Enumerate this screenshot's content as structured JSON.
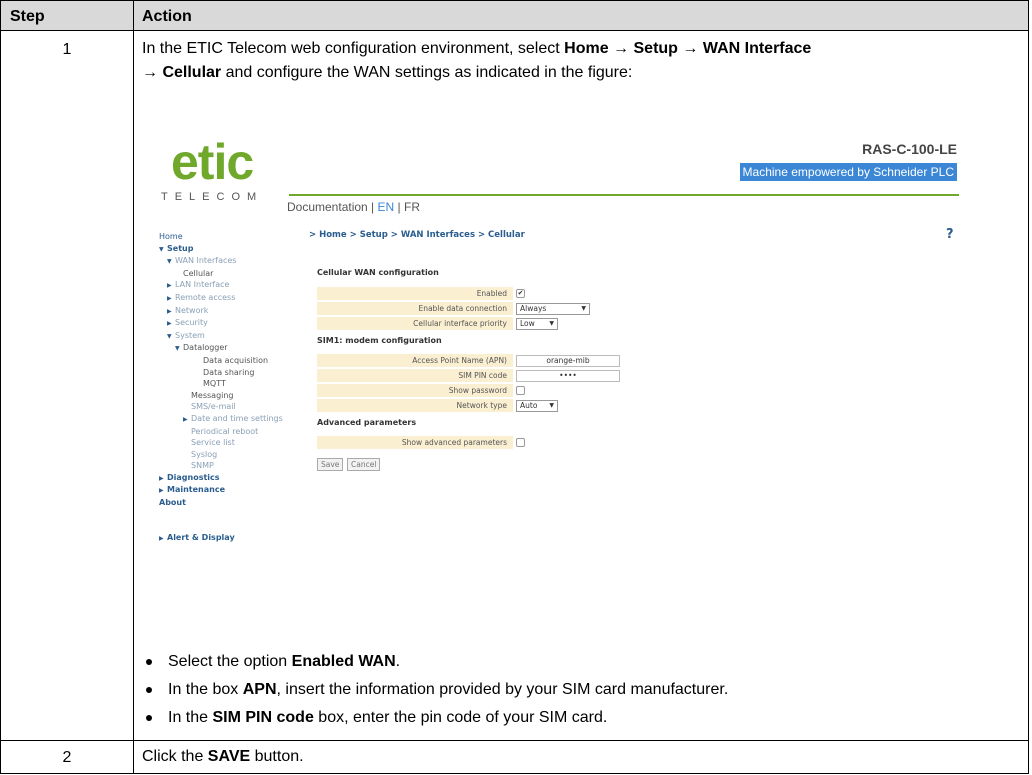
{
  "table": {
    "header_step": "Step",
    "header_action": "Action",
    "row1": {
      "step": "1",
      "intro_a": "In the ETIC Telecom web configuration environment, select ",
      "path": [
        "Home",
        "Setup",
        "WAN Interface",
        "Cellular"
      ],
      "arrow": "→",
      "intro_b": " and configure the WAN settings as indicated in the figure:",
      "bullets": [
        {
          "pre": "Select the option ",
          "bold": "Enabled WAN",
          "post": "."
        },
        {
          "pre": "In the box ",
          "bold": "APN",
          "post": ", insert the information provided by your SIM card manufacturer."
        },
        {
          "pre": "In the ",
          "bold": "SIM PIN code",
          "post": " box, enter the pin code of your SIM card."
        }
      ]
    },
    "row2": {
      "step": "2",
      "pre": "Click the ",
      "bold": "SAVE",
      "post": " button."
    }
  },
  "screenshot": {
    "logo_word": "etic",
    "logo_sub": "TELECOM",
    "device_name": "RAS-C-100-LE",
    "tagline": "Machine empowered by Schneider PLC",
    "doc_links": {
      "documentation": "Documentation",
      "sep1": " | ",
      "en": "EN",
      "sep2": " | ",
      "fr": "FR"
    },
    "breadcrumb": "> Home > Setup > WAN Interfaces > Cellular",
    "help": "?",
    "nav": {
      "home": "Home",
      "setup": "Setup",
      "wan_interfaces": "WAN Interfaces",
      "cellular": "Cellular",
      "lan_interface": "LAN Interface",
      "remote_access": "Remote access",
      "network": "Network",
      "security": "Security",
      "system": "System",
      "datalogger": "Datalogger",
      "data_acquisition": "Data acquisition",
      "data_sharing": "Data sharing",
      "mqtt": "MQTT",
      "messaging": "Messaging",
      "sms_email": "SMS/e-mail",
      "date_time": "Date and time settings",
      "periodical_reboot": "Periodical reboot",
      "service_list": "Service list",
      "syslog": "Syslog",
      "snmp": "SNMP",
      "diagnostics": "Diagnostics",
      "maintenance": "Maintenance",
      "about": "About",
      "alert_display": "Alert & Display"
    },
    "form": {
      "section_cellular": "Cellular WAN configuration",
      "enabled_label": "Enabled",
      "enabled_checked": true,
      "data_conn_label": "Enable data connection",
      "data_conn_value": "Always",
      "priority_label": "Cellular interface priority",
      "priority_value": "Low",
      "section_sim": "SIM1: modem configuration",
      "apn_label": "Access Point Name (APN)",
      "apn_value": "orange-mib",
      "pin_label": "SIM PIN code",
      "pin_value": "••••",
      "show_pw_label": "Show password",
      "net_type_label": "Network type",
      "net_type_value": "Auto",
      "section_adv": "Advanced parameters",
      "show_adv_label": "Show advanced parameters",
      "save": "Save",
      "cancel": "Cancel",
      "select_arrow": "▼",
      "check_mark": "✔"
    },
    "colors": {
      "brand_green": "#6fa82a",
      "link_blue": "#3b87d6",
      "nav_blue": "#2a5d8e",
      "field_bg": "#fbefd2"
    }
  }
}
